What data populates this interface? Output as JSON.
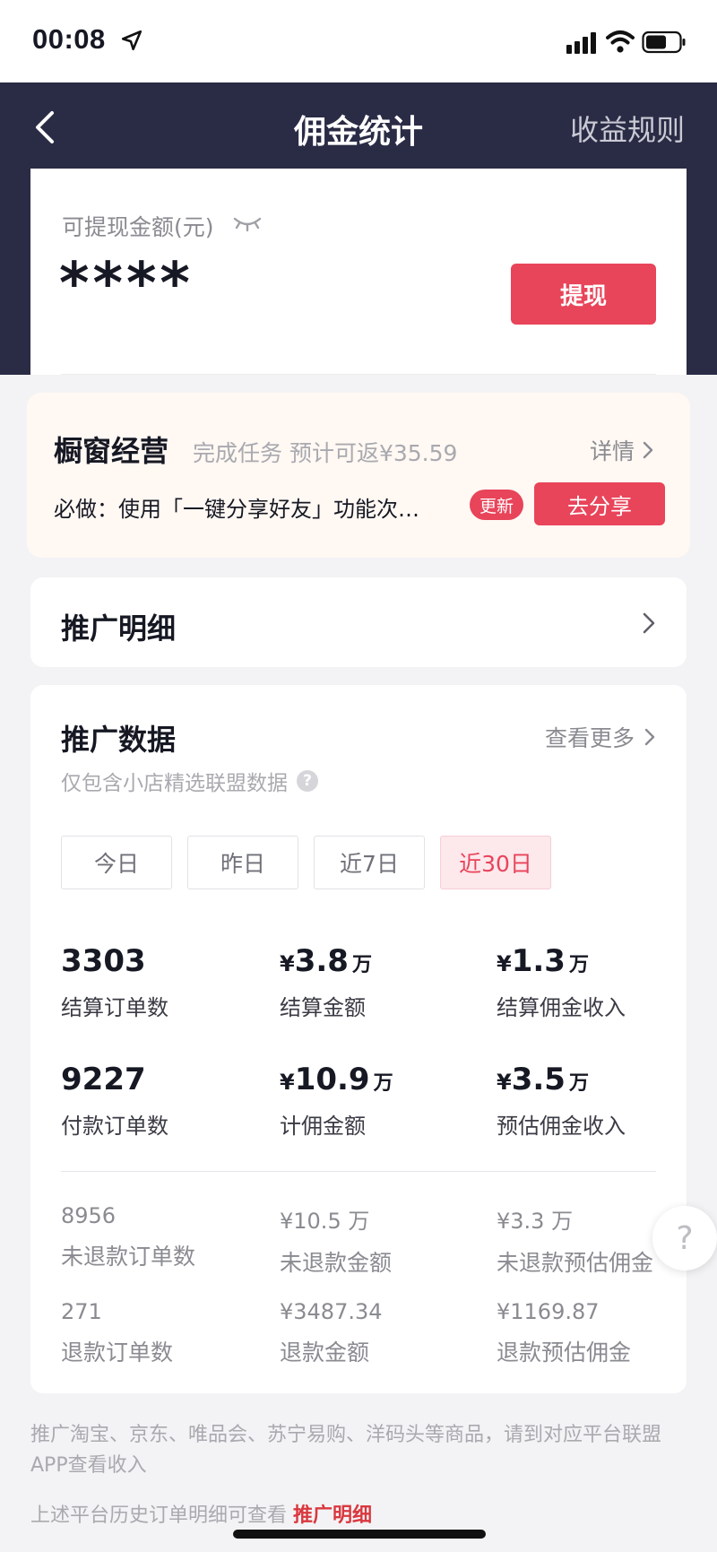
{
  "status_bar": {
    "time": "00:08"
  },
  "header": {
    "title": "佣金统计",
    "rules_link": "收益规则"
  },
  "balance": {
    "label": "可提现金额(元)",
    "value": "****",
    "withdraw_button": "提现"
  },
  "task": {
    "title": "橱窗经营",
    "subtitle": "完成任务 预计可返¥35.59",
    "detail_link": "详情",
    "description": "必做：使用「一键分享好友」功能次…",
    "badge": "更新",
    "action_button": "去分享"
  },
  "promo_detail": {
    "label": "推广明细"
  },
  "promo_data": {
    "title": "推广数据",
    "more_link": "查看更多",
    "note": "仅包含小店精选联盟数据",
    "tabs": [
      {
        "label": "今日",
        "active": false
      },
      {
        "label": "昨日",
        "active": false
      },
      {
        "label": "近7日",
        "active": false
      },
      {
        "label": "近30日",
        "active": true
      }
    ],
    "metrics": [
      {
        "symbol": "",
        "value": "3303",
        "unit": "",
        "label": "结算订单数"
      },
      {
        "symbol": "¥",
        "value": "3.8",
        "unit": "万",
        "label": "结算金额"
      },
      {
        "symbol": "¥",
        "value": "1.3",
        "unit": "万",
        "label": "结算佣金收入"
      },
      {
        "symbol": "",
        "value": "9227",
        "unit": "",
        "label": "付款订单数"
      },
      {
        "symbol": "¥",
        "value": "10.9",
        "unit": "万",
        "label": "计佣金额"
      },
      {
        "symbol": "¥",
        "value": "3.5",
        "unit": "万",
        "label": "预估佣金收入"
      }
    ],
    "submetrics": [
      {
        "value": "8956",
        "label": "未退款订单数"
      },
      {
        "value": "¥10.5 万",
        "label": "未退款金额"
      },
      {
        "value": "¥3.3 万",
        "label": "未退款预估佣金"
      },
      {
        "value": "271",
        "label": "退款订单数"
      },
      {
        "value": "¥3487.34",
        "label": "退款金额"
      },
      {
        "value": "¥1169.87",
        "label": "退款预估佣金"
      }
    ]
  },
  "footer": {
    "note": "推广淘宝、京东、唯品会、苏宁易购、洋码头等商品，请到对应平台联盟APP查看收入",
    "history_text": "上述平台历史订单明细可查看",
    "history_link": "推广明细"
  },
  "help_float": "?",
  "colors": {
    "accent": "#e8445a",
    "header_bg": "#2a2b45",
    "task_bg": "#fff8f3"
  },
  "icons": [
    "location-arrow-icon",
    "signal-icon",
    "wifi-icon",
    "battery-icon",
    "back-icon",
    "eye-closed-icon",
    "chevron-right-icon",
    "help-icon"
  ]
}
